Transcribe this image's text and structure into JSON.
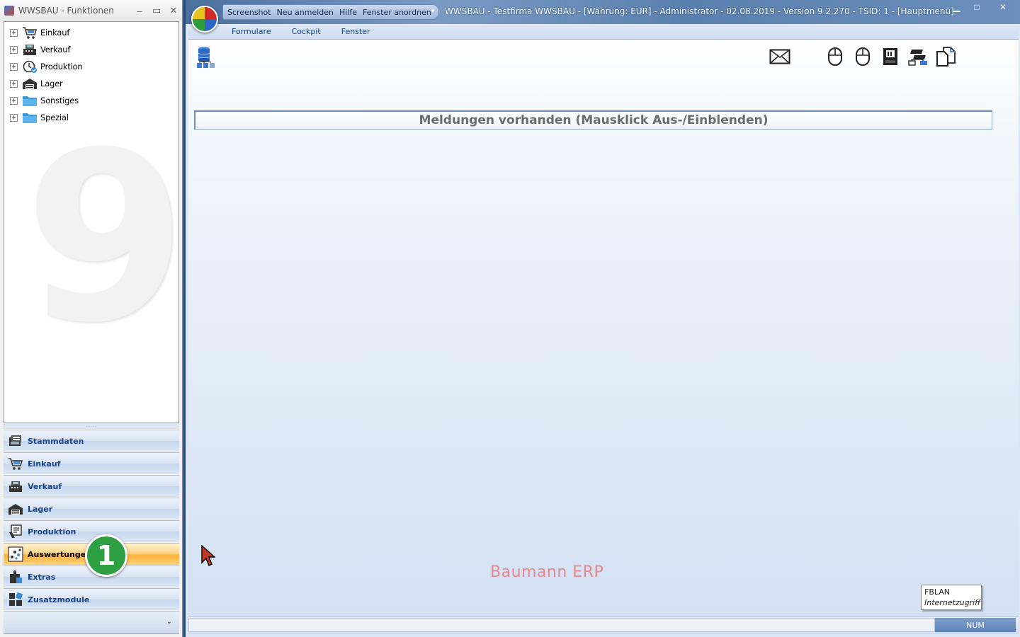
{
  "left_window": {
    "title": "WWSBAU - Funktionen",
    "minimize": "‒",
    "maximize": "▭",
    "close": "✕",
    "tree": [
      {
        "label": "Einkauf",
        "icon": "shopping-cart-icon"
      },
      {
        "label": "Verkauf",
        "icon": "cash-register-icon"
      },
      {
        "label": "Produktion",
        "icon": "clock-check-icon"
      },
      {
        "label": "Lager",
        "icon": "warehouse-icon"
      },
      {
        "label": "Sonstiges",
        "icon": "folder-icon"
      },
      {
        "label": "Spezial",
        "icon": "folder-icon"
      }
    ],
    "tree_expander": "+",
    "watermark": "9",
    "splitter_grip": ".....",
    "nav": [
      {
        "label": "Stammdaten",
        "icon": "master-data-icon",
        "active": false
      },
      {
        "label": "Einkauf",
        "icon": "shopping-cart-icon",
        "active": false
      },
      {
        "label": "Verkauf",
        "icon": "cash-register-icon",
        "active": false
      },
      {
        "label": "Lager",
        "icon": "warehouse-icon",
        "active": false
      },
      {
        "label": "Produktion",
        "icon": "production-icon",
        "active": false
      },
      {
        "label": "Auswertungen",
        "icon": "scatter-chart-icon",
        "active": true
      },
      {
        "label": "Extras",
        "icon": "puzzle-icon",
        "active": false
      },
      {
        "label": "Zusatzmodule",
        "icon": "modules-icon",
        "active": false
      }
    ],
    "nav_more": "⌄",
    "step_badge": "1"
  },
  "main_window": {
    "quick_access": [
      "Screenshot",
      "Neu anmelden",
      "Hilfe",
      "Fenster anordnen"
    ],
    "quick_access_dropdown": "▾",
    "caption": "WWSBAU - Testfirma WWSBAU - [Währung: EUR] - Administrator - 02.08.2019 - Version 9.2.270 - TSID: 1  - [Hauptmenü]",
    "minimize": "▁",
    "maximize": "□",
    "close": "✕",
    "menu": [
      "Formulare",
      "Cockpit",
      "Fenster"
    ],
    "toolbar_icons": [
      "database-icon",
      "mail-icon",
      "mouse-icon",
      "mouse-icon",
      "memory-card-icon",
      "network-icon",
      "documents-icon"
    ],
    "message_bar": "Meldungen vorhanden  (Mausklick Aus-/Einblenden)",
    "brand": "Baumann ERP",
    "tooltip": {
      "line1": "FBLAN",
      "line2": "Internetzugriff"
    },
    "status": {
      "num": "NUM"
    }
  },
  "colors": {
    "nav_label": "#15428b",
    "active_nav": "#ffb23a",
    "brand_text": "#e7868c",
    "badge": "#2ea043"
  }
}
